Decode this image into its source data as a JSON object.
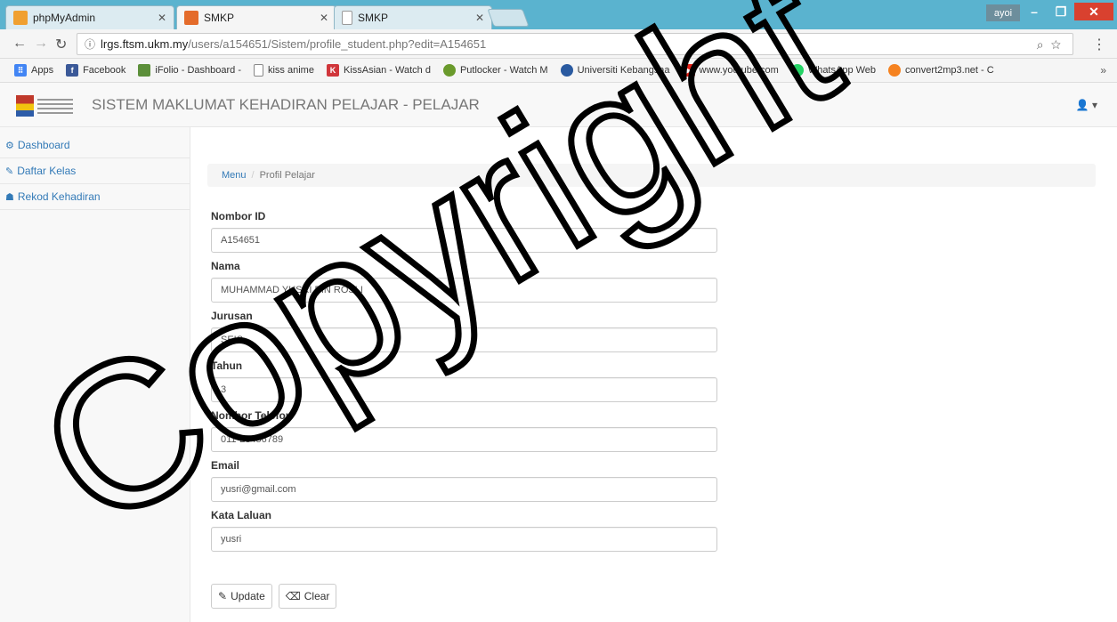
{
  "browser": {
    "tabs": [
      {
        "title": "phpMyAdmin",
        "favicon_color": "#f0a030"
      },
      {
        "title": "SMKP",
        "favicon_color": "#e46b2a",
        "active": true
      },
      {
        "title": "SMKP",
        "favicon_color": "#ffffff"
      }
    ],
    "profile_label": "ayoi",
    "url_host": "lrgs.ftsm.ukm.my",
    "url_path": "/users/a154651/Sistem/profile_student.php?edit=A154651",
    "bookmarks": [
      {
        "label": "Apps",
        "icon": "apps-icon",
        "color": "#4285f4"
      },
      {
        "label": "Facebook",
        "icon": "facebook-icon",
        "color": "#3b5998"
      },
      {
        "label": "iFolio - Dashboard -",
        "icon": "ifolio-icon",
        "color": "#5c8f3a"
      },
      {
        "label": "kiss anime",
        "icon": "page-icon",
        "color": "#ffffff"
      },
      {
        "label": "KissAsian - Watch d",
        "icon": "kissasian-icon",
        "color": "#d0363b"
      },
      {
        "label": "Putlocker - Watch M",
        "icon": "putlocker-icon",
        "color": "#6a9a2c"
      },
      {
        "label": "Universiti Kebangsaa",
        "icon": "ukm-icon",
        "color": "#2a5aa0"
      },
      {
        "label": "www.youtube.com",
        "icon": "youtube-icon",
        "color": "#e62117"
      },
      {
        "label": "WhatsApp Web",
        "icon": "whatsapp-icon",
        "color": "#25d366"
      },
      {
        "label": "convert2mp3.net - C",
        "icon": "convert-icon",
        "color": "#f58220"
      }
    ],
    "more_bookmarks": "»"
  },
  "app": {
    "brand": "SISTEM MAKLUMAT KEHADIRAN PELAJAR - PELAJAR",
    "user_menu": "▾"
  },
  "sidebar": {
    "items": [
      {
        "label": "Dashboard",
        "icon": "dashboard-icon",
        "glyph": "⚙"
      },
      {
        "label": "Daftar Kelas",
        "icon": "wrench-icon",
        "glyph": "✎"
      },
      {
        "label": "Rekod Kehadiran",
        "icon": "sitemap-icon",
        "glyph": "☗"
      }
    ]
  },
  "breadcrumb": {
    "link": "Menu",
    "separator": "/",
    "current": "Profil Pelajar"
  },
  "form": {
    "fields": [
      {
        "label": "Nombor ID",
        "value": "A154651"
      },
      {
        "label": "Nama",
        "value": "MUHAMMAD YUSRI BIN ROSLI"
      },
      {
        "label": "Jurusan",
        "value": "SEIS"
      },
      {
        "label": "Tahun",
        "value": "3"
      },
      {
        "label": "Nombor Telefon",
        "value": "011-23456789"
      },
      {
        "label": "Email",
        "value": "yusri@gmail.com"
      },
      {
        "label": "Kata Laluan",
        "value": "yusri"
      }
    ],
    "update_label": "Update",
    "clear_label": "Clear"
  },
  "watermark": "Copyright"
}
